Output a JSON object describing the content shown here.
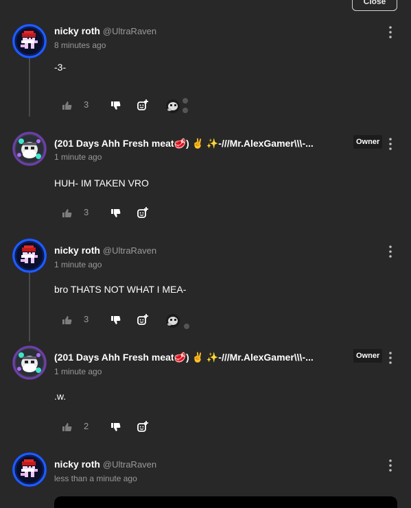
{
  "close_label": "Close",
  "comments": [
    {
      "name": "nicky roth",
      "handle": "@UltraRaven",
      "time": "8 minutes ago",
      "text": "-3-",
      "likes": "3",
      "reactions": true
    },
    {
      "name": "(201 Days Ahh Fresh meat🥩) ✌️ ✨-///Mr.AlexGamer\\\\\\-...",
      "handle": "",
      "time": "1 minute ago",
      "text": "HUH- IM TAKEN VRO",
      "likes": "3",
      "owner": "Owner",
      "reactions": false
    },
    {
      "name": "nicky roth",
      "handle": "@UltraRaven",
      "time": "1 minute ago",
      "text": "bro THATS NOT WHAT I MEA-",
      "likes": "3",
      "reactions": true
    },
    {
      "name": "(201 Days Ahh Fresh meat🥩) ✌️ ✨-///Mr.AlexGamer\\\\\\-...",
      "handle": "",
      "time": "1 minute ago",
      "text": ".w.",
      "likes": "2",
      "owner": "Owner",
      "reactions": false
    },
    {
      "name": "nicky roth",
      "handle": "@UltraRaven",
      "time": "less than a minute ago",
      "text": "",
      "likes": "",
      "reactions": false
    }
  ],
  "icons": {
    "like": "thumbs-up-icon",
    "dislike": "thumbs-down-icon",
    "react": "add-reaction-icon",
    "menu": "kebab-menu-icon"
  },
  "colors": {
    "background": "#282828",
    "text": "#ffffff",
    "muted": "#9a9a9a",
    "owner_bg": "#1c1c1c"
  }
}
